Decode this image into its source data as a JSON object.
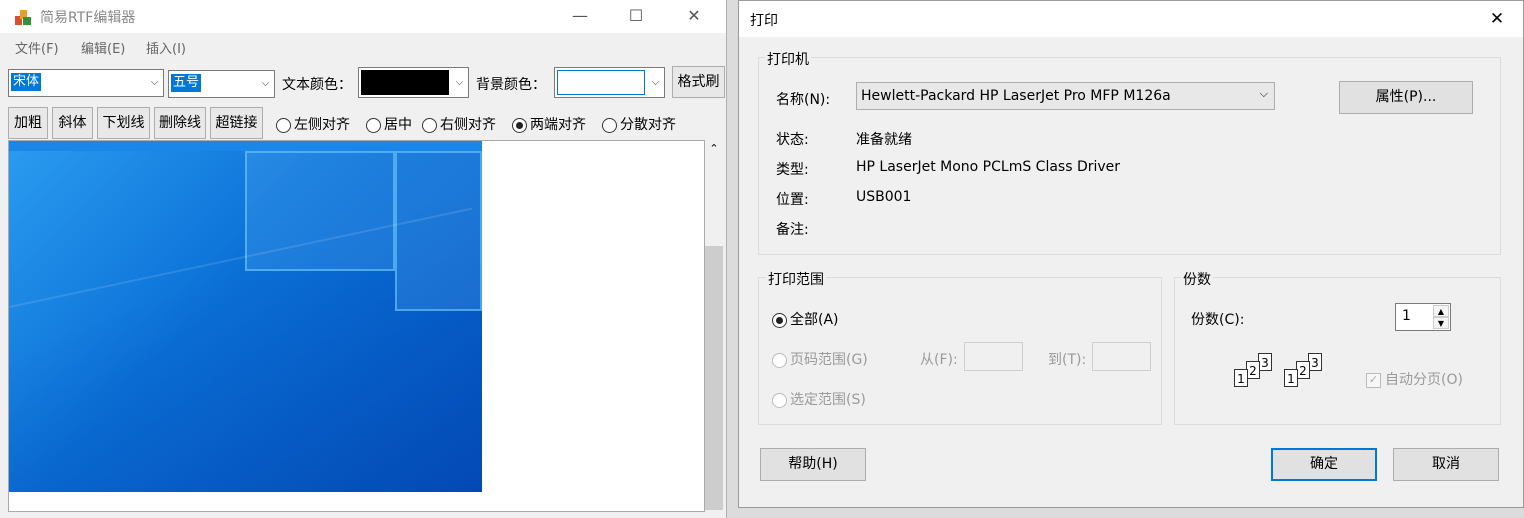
{
  "editor": {
    "title": "简易RTF编辑器",
    "menus": [
      "文件(F)",
      "编辑(E)",
      "插入(I)"
    ],
    "font_name": "宋体",
    "font_size": "五号",
    "text_color_label": "文本颜色：",
    "text_color": "#000000",
    "bg_color_label": "背景颜色：",
    "bg_color": "#ffffff",
    "format_brush": "格式刷",
    "style_buttons": [
      "加粗",
      "斜体",
      "下划线",
      "删除线",
      "超链接"
    ],
    "align_options": [
      {
        "label": "左侧对齐",
        "checked": false
      },
      {
        "label": "居中",
        "checked": false
      },
      {
        "label": "右侧对齐",
        "checked": false
      },
      {
        "label": "两端对齐",
        "checked": true
      },
      {
        "label": "分散对齐",
        "checked": false
      }
    ],
    "icons": {
      "minimize": "minimize-icon",
      "maximize": "maximize-icon",
      "close": "close-icon"
    }
  },
  "print": {
    "title": "打印",
    "printer_group": "打印机",
    "name_label": "名称(N):",
    "name_value": "Hewlett-Packard HP LaserJet Pro MFP M126a",
    "properties_button": "属性(P)...",
    "status_label": "状态:",
    "status_value": "准备就绪",
    "type_label": "类型:",
    "type_value": "HP LaserJet Mono PCLmS Class Driver",
    "location_label": "位置:",
    "location_value": "USB001",
    "comment_label": "备注:",
    "range_group": "打印范围",
    "range_all": "全部(A)",
    "range_pages": "页码范围(G)",
    "from_label": "从(F):",
    "to_label": "到(T):",
    "range_selection": "选定范围(S)",
    "copies_group": "份数",
    "copies_label": "份数(C):",
    "copies_value": "1",
    "collate_label": "自动分页(O)",
    "collate_checked": true,
    "collate_pages": [
      "1",
      "2",
      "3"
    ],
    "help_button": "帮助(H)",
    "ok_button": "确定",
    "cancel_button": "取消"
  }
}
